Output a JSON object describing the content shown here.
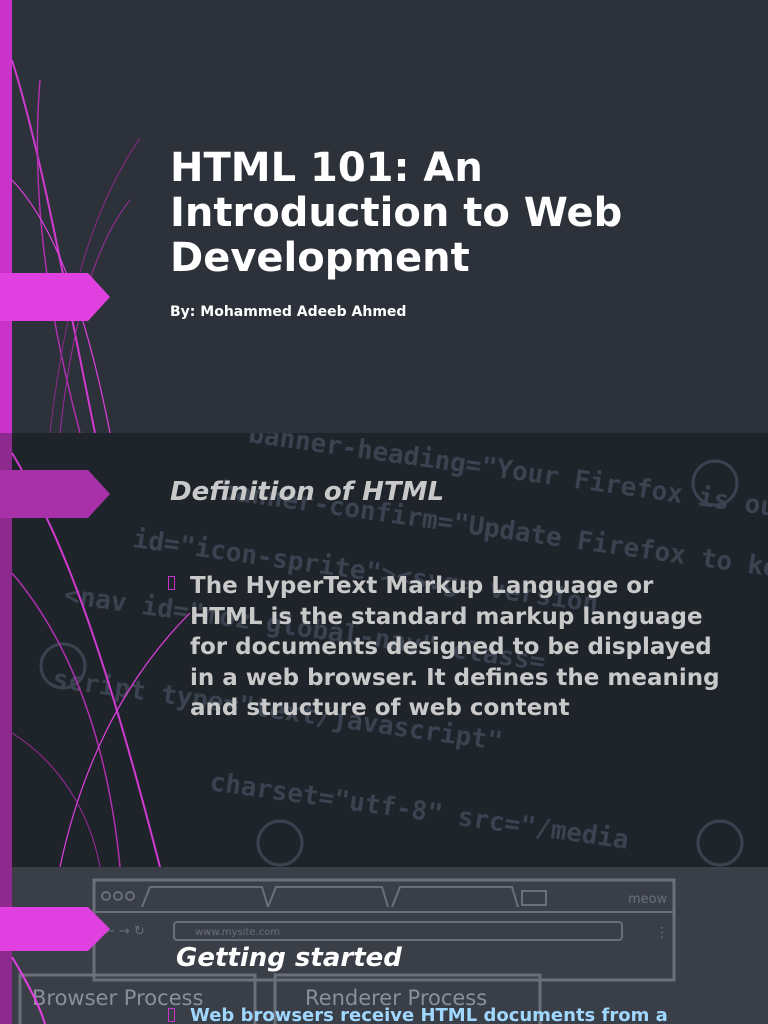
{
  "slides": {
    "title_slide": {
      "title": "HTML 101: An Introduction to Web Development",
      "author": "By: Mohammed Adeeb Ahmed"
    },
    "definition_slide": {
      "heading": "Definition of HTML",
      "bullet": "The HyperText Markup Language or HTML is the standard markup language for documents designed to be displayed in a web browser. It defines the meaning and structure of web content",
      "background_code": [
        "banner-heading=\"Your Firefox is out-of-date",
        "banner-confirm=\"Update Firefox to keep",
        "id=\"icon-sprite\"><svg> version",
        "<nav id=\"moz-global-nav\" class=",
        "script type=\"text/javascript\"",
        "charset=\"utf-8\" src=\"/media"
      ]
    },
    "getting_started_slide": {
      "heading": "Getting started",
      "bullet": "Web browsers receive HTML documents from a",
      "browser_url": "www.mysite.com",
      "browser_brand": "meow",
      "process_labels": [
        "Browser Process",
        "Renderer Process"
      ]
    }
  },
  "colors": {
    "accent": "#e040e0",
    "accent_dark": "#c933c9",
    "slide_bg": "#2d3139"
  }
}
